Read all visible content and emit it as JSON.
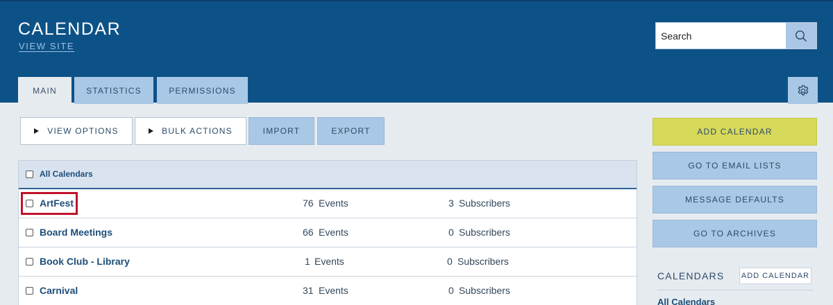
{
  "header": {
    "title": "CALENDAR",
    "view_site": "VIEW SITE",
    "search_placeholder": "Search",
    "search_icon": "search-icon",
    "settings_icon": "gear-icon"
  },
  "tabs": [
    {
      "label": "MAIN",
      "active": true
    },
    {
      "label": "STATISTICS",
      "active": false
    },
    {
      "label": "PERMISSIONS",
      "active": false
    }
  ],
  "toolbar": {
    "view_options": "VIEW OPTIONS",
    "bulk_actions": "BULK ACTIONS",
    "import": "IMPORT",
    "export": "EXPORT"
  },
  "table": {
    "header_label": "All Calendars",
    "rows": [
      {
        "name": "ArtFest",
        "events_count": "76",
        "events_label": "Events",
        "subscribers_count": "3",
        "subscribers_label": "Subscribers",
        "checked": false
      },
      {
        "name": "Board Meetings",
        "events_count": "66",
        "events_label": "Events",
        "subscribers_count": "0",
        "subscribers_label": "Subscribers",
        "checked": false
      },
      {
        "name": "Book Club - Library",
        "events_count": "1",
        "events_label": "Events",
        "subscribers_count": "0",
        "subscribers_label": "Subscribers",
        "checked": false
      },
      {
        "name": "Carnival",
        "events_count": "31",
        "events_label": "Events",
        "subscribers_count": "0",
        "subscribers_label": "Subscribers",
        "checked": false
      }
    ]
  },
  "sidebar": {
    "buttons": [
      "ADD CALENDAR",
      "GO TO EMAIL LISTS",
      "MESSAGE DEFAULTS",
      "GO TO ARCHIVES"
    ],
    "calendars_heading": "CALENDARS",
    "add_calendar_small": "ADD CALENDAR",
    "all_calendars_link": "All Calendars"
  },
  "colors": {
    "header_bg": "#0d5287",
    "tab_bg": "#a9c8e5",
    "add_button_bg": "#d7d95a",
    "link": "#1d4e7a",
    "highlight_border": "#c0122a"
  }
}
